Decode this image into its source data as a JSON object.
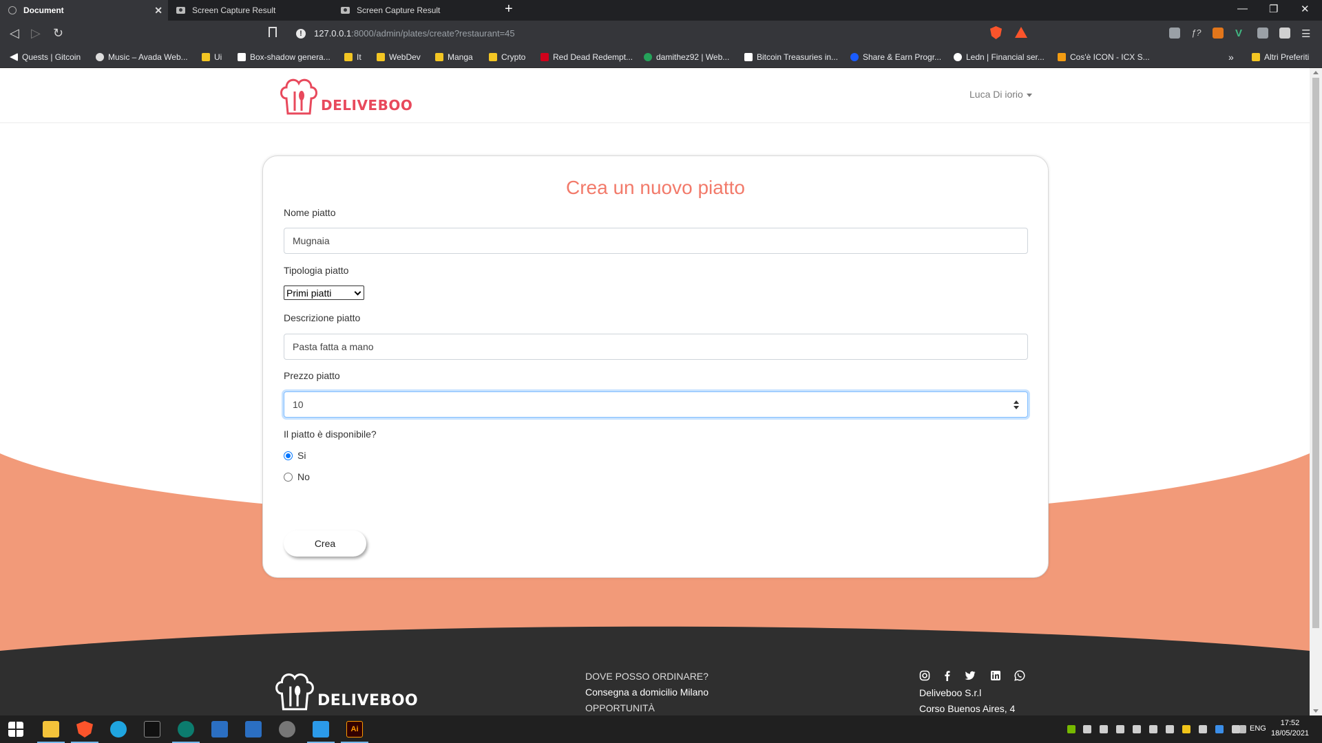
{
  "browser": {
    "tabs": [
      {
        "title": "Document",
        "active": true
      },
      {
        "title": "Screen Capture Result",
        "active": false
      },
      {
        "title": "Screen Capture Result",
        "active": false
      }
    ],
    "url_host": "127.0.0.1",
    "url_rest": ":8000/admin/plates/create?restaurant=45",
    "alert_badge": "1",
    "bookmarks": [
      "Quests | Gitcoin",
      "Music – Avada Web...",
      "Ui",
      "Box-shadow genera...",
      "It",
      "WebDev",
      "Manga",
      "Crypto",
      "Red Dead Redempt...",
      "damithez92 | Web...",
      "Bitcoin Treasuries in...",
      "Share & Earn Progr...",
      "Ledn | Financial ser...",
      "Cos'è ICON - ICX S..."
    ],
    "bookmarks_more": "»",
    "other_bookmarks": "Altri Preferiti"
  },
  "header": {
    "logo_text": "DELIVEBOO",
    "user_name": "Luca Di iorio"
  },
  "form": {
    "title": "Crea un nuovo piatto",
    "name_label": "Nome piatto",
    "name_value": "Mugnaia",
    "type_label": "Tipologia piatto",
    "type_selected": "Primi piatti",
    "description_label": "Descrizione piatto",
    "description_value": "Pasta fatta a mano",
    "price_label": "Prezzo piatto",
    "price_value": "10",
    "available_label": "Il piatto è disponibile?",
    "options": [
      {
        "label": "Si",
        "checked": true
      },
      {
        "label": "No",
        "checked": false
      }
    ],
    "submit_label": "Crea"
  },
  "footer": {
    "logo_text": "DELIVEBOO",
    "links": [
      "DOVE POSSO ORDINARE?",
      "Consegna a domicilio Milano",
      "OPPORTUNITÀ"
    ],
    "company_name": "Deliveboo S.r.l",
    "company_address": "Corso Buenos Aires, 4",
    "social_icons": [
      "instagram-icon",
      "facebook-icon",
      "twitter-icon",
      "linkedin-icon",
      "whatsapp-icon"
    ]
  },
  "taskbar": {
    "language": "ENG",
    "time": "17:52",
    "date": "18/05/2021"
  },
  "colors": {
    "accent": "#f27a6a",
    "wave": "#f29a79",
    "footer": "#2f2f2f",
    "brand": "#e8495c"
  }
}
